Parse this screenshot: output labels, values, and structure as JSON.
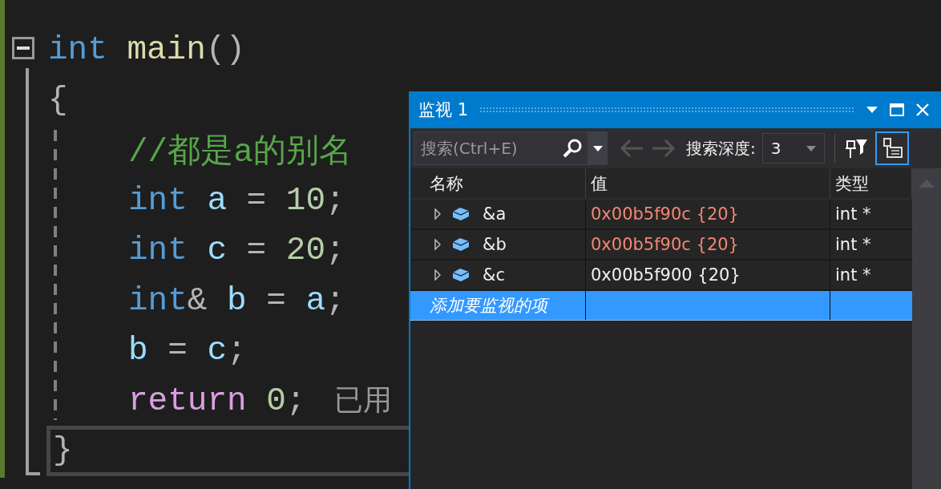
{
  "editor": {
    "lines": [
      {
        "expanded": true,
        "tokens": [
          {
            "text": "int",
            "kind": "keyword"
          },
          {
            "text": "main",
            "kind": "function",
            "space_before": true
          },
          {
            "text": "()",
            "kind": "punct"
          }
        ],
        "children": [
          {
            "tokens": [
              {
                "text": "{",
                "kind": "punct"
              }
            ],
            "children": [
              {
                "tokens": [
                  {
                    "text": "//都是a的别名",
                    "kind": "comment"
                  }
                ]
              },
              {
                "tokens": [
                  {
                    "text": "int",
                    "kind": "keyword"
                  },
                  {
                    "text": "a",
                    "kind": "variable",
                    "space_before": true
                  },
                  {
                    "text": "=",
                    "kind": "punct",
                    "space_before": true
                  },
                  {
                    "text": "10",
                    "kind": "number",
                    "space_before": true
                  },
                  {
                    "text": ";",
                    "kind": "punct"
                  }
                ]
              },
              {
                "tokens": [
                  {
                    "text": "int",
                    "kind": "keyword"
                  },
                  {
                    "text": "c",
                    "kind": "variable",
                    "space_before": true
                  },
                  {
                    "text": "=",
                    "kind": "punct",
                    "space_before": true
                  },
                  {
                    "text": "20",
                    "kind": "number",
                    "space_before": true
                  },
                  {
                    "text": ";",
                    "kind": "punct"
                  }
                ]
              },
              {
                "tokens": [
                  {
                    "text": "int",
                    "kind": "keyword"
                  },
                  {
                    "text": "&",
                    "kind": "punct"
                  },
                  {
                    "text": "b",
                    "kind": "variable",
                    "space_before": true
                  },
                  {
                    "text": "=",
                    "kind": "punct",
                    "space_before": true
                  },
                  {
                    "text": "a",
                    "kind": "variable",
                    "space_before": true
                  },
                  {
                    "text": ";",
                    "kind": "punct"
                  }
                ]
              },
              {
                "tokens": [
                  {
                    "text": "b",
                    "kind": "variable"
                  },
                  {
                    "text": "=",
                    "kind": "punct",
                    "space_before": true
                  },
                  {
                    "text": "c",
                    "kind": "variable",
                    "space_before": true
                  },
                  {
                    "text": ";",
                    "kind": "punct"
                  }
                ]
              },
              {
                "tokens": [
                  {
                    "text": "return",
                    "kind": "control"
                  },
                  {
                    "text": "0",
                    "kind": "number",
                    "space_before": true
                  },
                  {
                    "text": ";",
                    "kind": "punct"
                  },
                  {
                    "text": "已用",
                    "kind": "hint"
                  }
                ]
              }
            ]
          },
          {
            "current": true,
            "tokens": [
              {
                "text": "}",
                "kind": "punct"
              }
            ]
          }
        ]
      }
    ]
  },
  "watch": {
    "title": "监视 1",
    "search": {
      "placeholder": "搜索(Ctrl+E)"
    },
    "depth_label": "搜索深度:",
    "depth_value": "3",
    "columns": [
      "名称",
      "值",
      "类型"
    ],
    "rows": [
      {
        "name": "&a",
        "value": "0x00b5f90c {20}",
        "type": "int *",
        "changed": true,
        "expanded": false
      },
      {
        "name": "&b",
        "value": "0x00b5f90c {20}",
        "type": "int *",
        "changed": true,
        "expanded": false
      },
      {
        "name": "&c",
        "value": "0x00b5f900 {20}",
        "type": "int *",
        "changed": false,
        "expanded": false
      }
    ],
    "add_row": {
      "placeholder": "添加要监视的项",
      "selected": true
    }
  }
}
